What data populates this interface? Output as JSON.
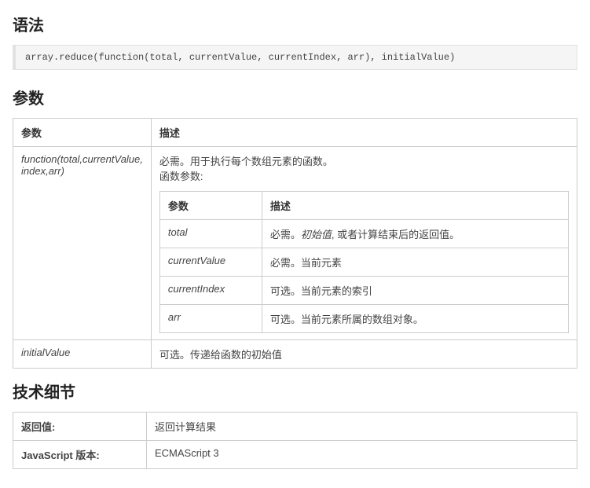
{
  "syntax": {
    "heading": "语法",
    "code": "array.reduce(function(total, currentValue, currentIndex, arr), initialValue)"
  },
  "params": {
    "heading": "参数",
    "col_param": "参数",
    "col_desc": "描述",
    "row1": {
      "param": "function(total,currentValue, index,arr)",
      "desc_line1": "必需。用于执行每个数组元素的函数。",
      "desc_line2": "函数参数:",
      "inner_col_param": "参数",
      "inner_col_desc": "描述",
      "inner_rows": [
        {
          "param": "total",
          "desc_prefix": "必需。",
          "desc_italic": "初始值",
          "desc_suffix": ", 或者计算结束后的返回值。"
        },
        {
          "param": "currentValue",
          "desc_prefix": "必需。当前元素",
          "desc_italic": "",
          "desc_suffix": ""
        },
        {
          "param": "currentIndex",
          "desc_prefix": "可选。当前元素的索引",
          "desc_italic": "",
          "desc_suffix": ""
        },
        {
          "param": "arr",
          "desc_prefix": "可选。当前元素所属的数组对象。",
          "desc_italic": "",
          "desc_suffix": ""
        }
      ]
    },
    "row2": {
      "param": "initialValue",
      "desc": "可选。传递给函数的初始值"
    }
  },
  "tech": {
    "heading": "技术细节",
    "rows": [
      {
        "label": "返回值:",
        "value": "返回计算结果"
      },
      {
        "label": "JavaScript 版本:",
        "value": "ECMAScript 3"
      }
    ]
  }
}
